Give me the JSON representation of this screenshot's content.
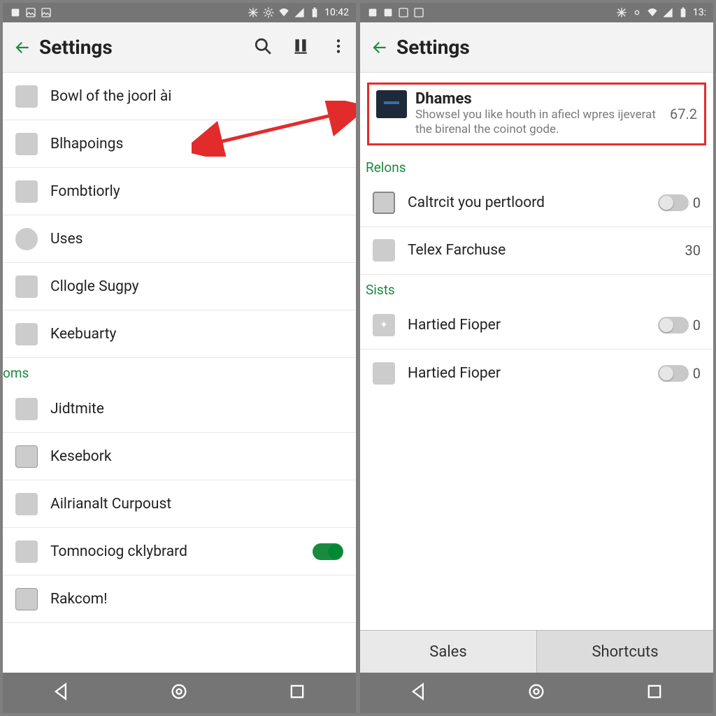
{
  "left": {
    "statusbar": {
      "time": "10:42"
    },
    "appbar": {
      "title": "Settings"
    },
    "items": [
      {
        "label": "Bowl of the joorl ài"
      },
      {
        "label": "Blhapoings"
      },
      {
        "label": "Fombtiorly"
      },
      {
        "label": "Uses"
      },
      {
        "label": "Cllogle Sugpy"
      },
      {
        "label": "Keebuarty"
      }
    ],
    "section1": "oms",
    "items2": [
      {
        "label": "Jidtmite"
      },
      {
        "label": "Kesebork"
      },
      {
        "label": "Ailrianalt Curpoust"
      },
      {
        "label": "Tomnociog cklybrard",
        "toggle_on": true
      },
      {
        "label": "Rakcom!"
      }
    ]
  },
  "right": {
    "statusbar": {
      "time": "13:"
    },
    "appbar": {
      "title": "Settings"
    },
    "card": {
      "title": "Dhames",
      "desc": "Showsel you like houth in afiecl wpres ijeverat the birenal the coinot gode.",
      "value": "67.2"
    },
    "section_relons": "Relons",
    "relons": [
      {
        "label": "Caltrcit you pertloord",
        "kind": "toggle",
        "value": "0"
      },
      {
        "label": "Telex Farchuse",
        "kind": "value",
        "value": "30"
      }
    ],
    "section_sists": "Sists",
    "sists": [
      {
        "label": "Hartied Fioper",
        "kind": "toggle",
        "value": "0"
      },
      {
        "label": "Hartied Fioper",
        "kind": "toggle",
        "value": "0"
      }
    ],
    "tabs": {
      "sales": "Sales",
      "shortcuts": "Shortcuts"
    }
  }
}
